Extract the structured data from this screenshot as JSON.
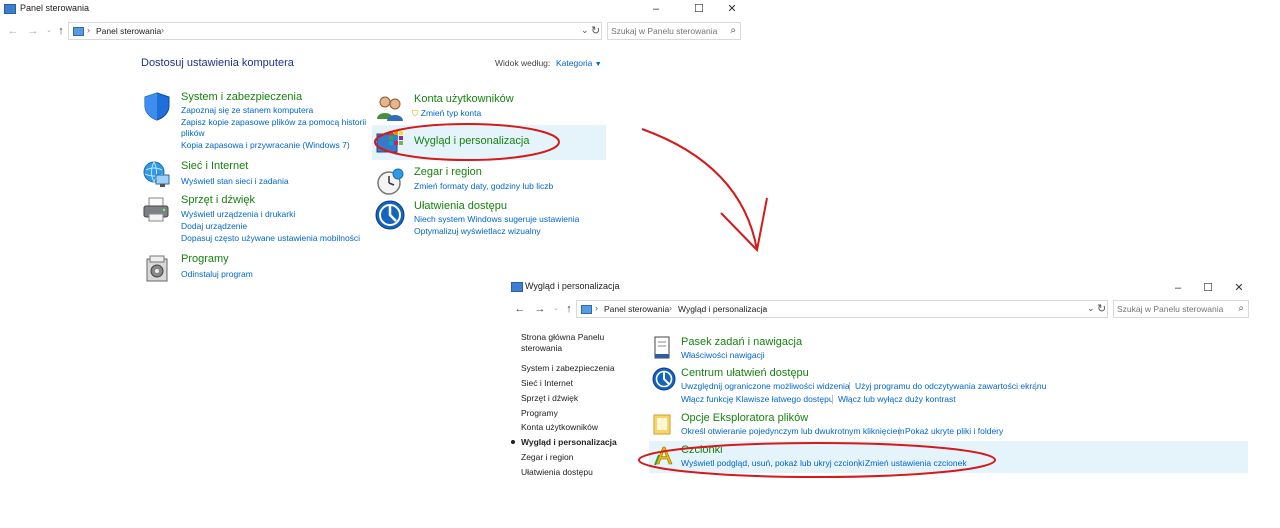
{
  "window1": {
    "title": "Panel sterowania",
    "address": [
      "Panel sterowania"
    ],
    "search_placeholder": "Szukaj w Panelu sterowania",
    "heading": "Dostosuj ustawienia komputera",
    "view_by_label": "Widok według:",
    "view_by_value": "Kategoria",
    "categories_left": [
      {
        "title": "System i zabezpieczenia",
        "links": [
          "Zapoznaj się ze stanem komputera",
          "Zapisz kopie zapasowe plików za pomocą historii",
          "plików",
          "Kopia zapasowa i przywracanie (Windows 7)"
        ]
      },
      {
        "title": "Sieć i Internet",
        "links": [
          "Wyświetl stan sieci i zadania"
        ]
      },
      {
        "title": "Sprzęt i dźwięk",
        "links": [
          "Wyświetl urządzenia i drukarki",
          "Dodaj urządzenie",
          "Dopasuj często używane ustawienia mobilności"
        ]
      },
      {
        "title": "Programy",
        "links": [
          "Odinstaluj program"
        ]
      }
    ],
    "categories_right": [
      {
        "title": "Konta użytkowników",
        "links": [
          "Zmień typ konta"
        ]
      },
      {
        "title": "Wygląd i personalizacja",
        "links": []
      },
      {
        "title": "Zegar i region",
        "links": [
          "Zmień formaty daty, godziny lub liczb"
        ]
      },
      {
        "title": "Ułatwienia dostępu",
        "links": [
          "Niech system Windows sugeruje ustawienia",
          "Optymalizuj wyświetlacz wizualny"
        ]
      }
    ]
  },
  "window2": {
    "title": "Wygląd i personalizacja",
    "address": [
      "Panel sterowania",
      "Wygląd i personalizacja"
    ],
    "search_placeholder": "Szukaj w Panelu sterowania",
    "sidebar": {
      "home": [
        "Strona główna Panelu",
        "sterowania"
      ],
      "items": [
        "System i zabezpieczenia",
        "Sieć i Internet",
        "Sprzęt i dźwięk",
        "Programy",
        "Konta użytkowników",
        "Wygląd i personalizacja",
        "Zegar i region",
        "Ułatwienia dostępu"
      ],
      "active_index": 5
    },
    "sections": [
      {
        "title": "Pasek zadań i nawigacja",
        "links": [
          "Właściwości nawigacji"
        ]
      },
      {
        "title": "Centrum ułatwień dostępu",
        "links": [
          "Uwzględnij ograniczone możliwości widzenia",
          "Użyj programu do odczytywania zawartości ekranu",
          "Włącz funkcję Klawisze łatwego dostępu",
          "Włącz lub wyłącz duży kontrast"
        ]
      },
      {
        "title": "Opcje Eksploratora plików",
        "links": [
          "Określ otwieranie pojedynczym lub dwukrotnym kliknięciem",
          "Pokaż ukryte pliki i foldery"
        ]
      },
      {
        "title": "Czcionki",
        "links": [
          "Wyświetl podgląd, usuń, pokaż lub ukryj czcionki",
          "Zmień ustawienia czcionek"
        ]
      }
    ]
  },
  "colors": {
    "link": "#0066cc",
    "category_title": "#16820f",
    "heading": "#1e3287",
    "highlight": "#e5f3fb",
    "annotation": "#d41a1a"
  }
}
